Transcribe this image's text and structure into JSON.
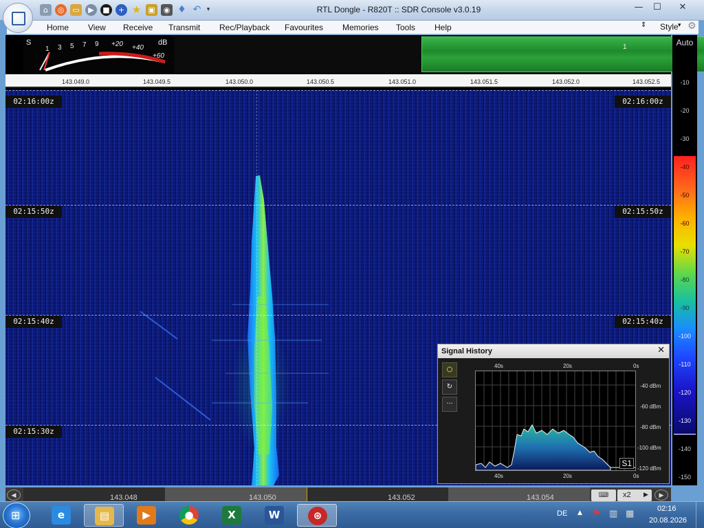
{
  "window": {
    "title": "RTL Dongle - R820T :: SDR Console v3.0.19",
    "controls": {
      "minimize": "—",
      "maximize": "☐",
      "close": "✕"
    }
  },
  "menu": {
    "items": [
      "Home",
      "View",
      "Receive",
      "Transmit",
      "Rec/Playback",
      "Favourites",
      "Memories",
      "Tools",
      "Help"
    ],
    "style": "Style"
  },
  "smeter": {
    "s_label": "S",
    "db_label": "dB",
    "scale": [
      "1",
      "3",
      "5",
      "7",
      "9",
      "+20",
      "+40",
      "+60"
    ]
  },
  "spectrum": {
    "marker": "1"
  },
  "freq_ruler": [
    "143.049.0",
    "143.049.5",
    "143.050.0",
    "143.050.5",
    "143.051.0",
    "143.051.5",
    "143.052.0",
    "143.052.5"
  ],
  "waterfall": {
    "timestamps": [
      "02:16:00z",
      "02:15:50z",
      "02:15:40z",
      "02:15:30z"
    ]
  },
  "bottom_scale": [
    "143.048",
    "143.050",
    "143.052",
    "143.054"
  ],
  "bottom_controls": {
    "zoom": "x2"
  },
  "db_scale": {
    "auto": "Auto",
    "levels": [
      "-10",
      "-20",
      "-30",
      "-40",
      "-50",
      "-60",
      "-70",
      "-80",
      "-90",
      "-100",
      "-110",
      "-120",
      "-130",
      "-140",
      "-150"
    ]
  },
  "signal_history": {
    "title": "Signal History",
    "close": "✕",
    "time_labels_top": [
      "40s",
      "20s",
      "0s"
    ],
    "time_labels_bottom": [
      "40s",
      "20s",
      "0s"
    ],
    "dbm_labels": [
      "-40 dBm",
      "-60 dBm",
      "-80 dBm",
      "-100 dBm",
      "-120 dBm"
    ],
    "s_badge": "S1",
    "tools": [
      "○",
      "↻",
      "···"
    ]
  },
  "taskbar": {
    "apps": [
      "internet-explorer",
      "file-explorer",
      "media-player",
      "chrome",
      "excel",
      "word",
      "sdr-console"
    ],
    "language": "DE",
    "time": "02:16",
    "date": "20.08.2026"
  }
}
